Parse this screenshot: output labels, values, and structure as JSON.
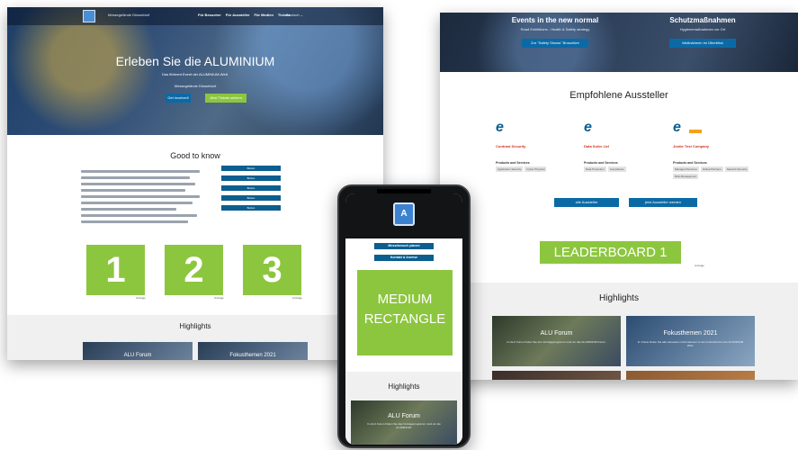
{
  "left": {
    "nav": {
      "tagline": "Messegelände Düsseldorf",
      "items": [
        "Für Besucher",
        "Für Aussteller",
        "Für Medien",
        "Tickets"
      ],
      "lang": "Deutsch ⌄"
    },
    "hero": {
      "title": "Erleben Sie die ALUMINIUM",
      "subtitle": "Das fführent Event der ALUMINIUM-Welt.",
      "venue": "Messegelände Düsseldorf",
      "btn_blue": "Get involved!",
      "btn_green": "Jetzt Tickets sichern"
    },
    "good_to_know": {
      "title": "Good to know",
      "buttons": [
        "Button",
        "Button",
        "Button",
        "Button",
        "Button"
      ]
    },
    "number_ads": {
      "labels": [
        "1",
        "2",
        "3"
      ],
      "caption": "Anzeige"
    },
    "highlights": {
      "title": "Highlights",
      "tiles": [
        "ALU Forum",
        "Fokusthemen 2021"
      ]
    }
  },
  "right": {
    "hero": {
      "col1_title": "Events in the new normal",
      "col1_sub": "Road Exhibitions - Health & Safety strategy",
      "col1_btn": "Zur \"Safety Shows\" Broschüre",
      "col2_title": "Schutzmaßnahmen",
      "col2_sub": "Hygienemaßnahmen vor Ort",
      "col2_btn": "Maßnahmen im Überblick"
    },
    "recommended": {
      "title": "Empfohlene Aussteller",
      "exhibitors": [
        {
          "name": "Contrast Security",
          "ps": "Products and Services",
          "tags": [
            "Application Security",
            "Cyber Physical"
          ]
        },
        {
          "name": "Data Solve Ltd",
          "ps": "Products and Services",
          "tags": [
            "Data Protection",
            "Compliance"
          ]
        },
        {
          "name": "Jonite Test Company",
          "ps": "Products and Services",
          "tags": [
            "Managed Services",
            "Global Partners",
            "Network Security",
            "Risk Management"
          ]
        }
      ],
      "btn_all": "alle Aussteller",
      "btn_become": "jetzt Aussteller werden"
    },
    "leaderboard": {
      "label": "LEADERBOARD 1",
      "caption": "Anzeige"
    },
    "highlights": {
      "title": "Highlights",
      "tiles": [
        {
          "title": "ALU Forum",
          "desc": "Im ALU Forum finden Sie den Vortragsprogramm rund um das ALUMINIUM Forum."
        },
        {
          "title": "Fokusthemen 2021",
          "desc": "Im Fokus finden Sie alle relevanten Informationen zu den Fokusthemen der ALUMINIUM 2021."
        }
      ]
    }
  },
  "phone": {
    "logo": "A",
    "buttons": [
      "Messebesuch planen",
      "Kontakt & Anreise"
    ],
    "medium_rect": [
      "MEDIUM",
      "RECTANGLE"
    ],
    "highlights_title": "Highlights",
    "tile": {
      "title": "ALU Forum",
      "desc": "Im ALU Forum finden Sie das Vortragsprogramm rund um die ALUMINIUM."
    }
  }
}
